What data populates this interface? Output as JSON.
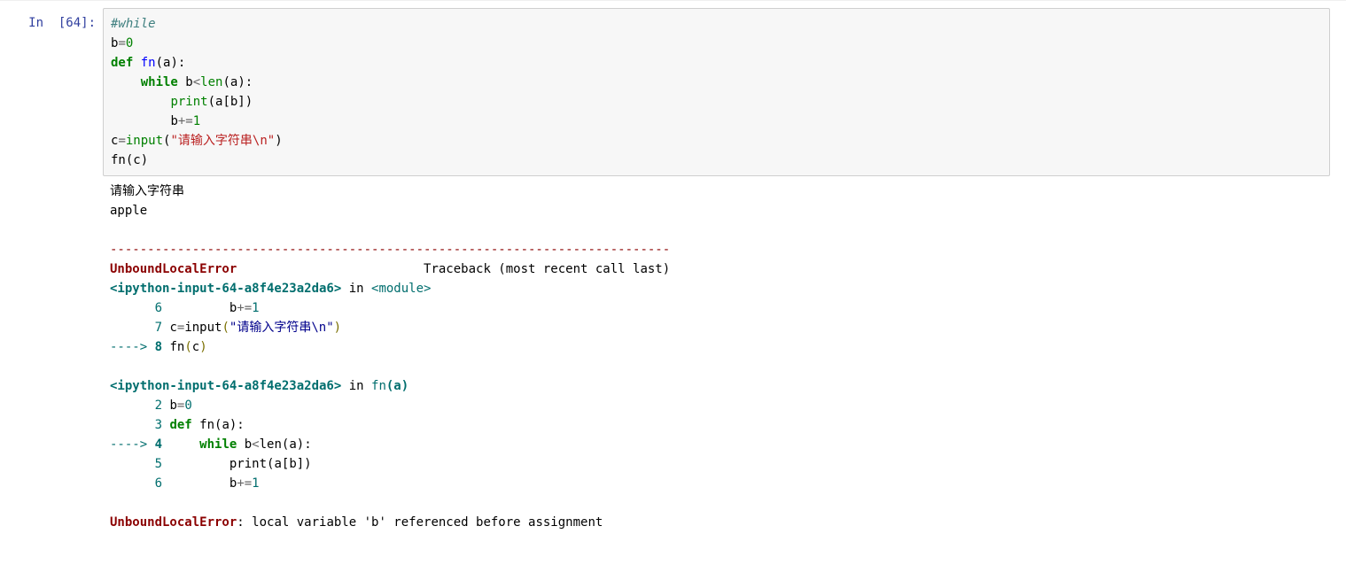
{
  "prompt": {
    "in_label": "In  [64]:"
  },
  "code": {
    "l1_comment": "#while",
    "l2_b": "b",
    "l2_eq": "=",
    "l2_zero": "0",
    "l3_def": "def",
    "l3_fn": " fn",
    "l3_open": "(a):",
    "l4_indent": "    ",
    "l4_while": "while",
    "l4_rest1": " b",
    "l4_lt": "<",
    "l4_len": "len",
    "l4_rest2": "(a):",
    "l5_indent": "        ",
    "l5_print": "print",
    "l5_rest": "(a[b])",
    "l6_indent": "        ",
    "l6_b": "b",
    "l6_peq": "+=",
    "l6_one": "1",
    "l7_c": "c",
    "l7_eq": "=",
    "l7_input": "input",
    "l7_open": "(",
    "l7_str": "\"请输入字符串\\n\"",
    "l7_close": ")",
    "l8": "fn(c)"
  },
  "out": {
    "stdin_line1": "请输入字符串",
    "stdin_line2": "apple",
    "hr": "---------------------------------------------------------------------------",
    "err_name": "UnboundLocalError",
    "err_pad": "                         ",
    "trace_tail": "Traceback (most recent call last)",
    "src1_a": "<ipython-input-64-a8f4e23a2da6>",
    "src1_in": " in ",
    "src1_mod": "<module>",
    "t1_l6_pre": "      ",
    "t1_l6_num": "6",
    "t1_l6_code": "         b",
    "t1_l6_op": "+=",
    "t1_l6_one": "1",
    "t1_l7_pre": "      ",
    "t1_l7_num": "7",
    "t1_l7_code_a": " c",
    "t1_l7_code_eq": "=",
    "t1_l7_code_b": "input",
    "t1_l7_code_p1": "(",
    "t1_l7_code_str": "\"请输入字符串\\n\"",
    "t1_l7_code_p2": ")",
    "t1_l8_arrow": "----> ",
    "t1_l8_num": "8",
    "t1_l8_code": " fn",
    "t1_l8_paren": "(",
    "t1_l8_arg": "c",
    "t1_l8_close": ")",
    "src2_a": "<ipython-input-64-a8f4e23a2da6>",
    "src2_in": " in ",
    "src2_fn": "fn",
    "src2_args": "(a)",
    "t2_l2_pre": "      ",
    "t2_l2_num": "2",
    "t2_l2_code": " b",
    "t2_l2_eq": "=",
    "t2_l2_zero": "0",
    "t2_l3_pre": "      ",
    "t2_l3_num": "3",
    "t2_l3_def": " def",
    "t2_l3_rest": " fn(a):",
    "t2_l4_arrow": "----> ",
    "t2_l4_num": "4",
    "t2_l4_while": "     while",
    "t2_l4_rest1": " b",
    "t2_l4_lt": "<",
    "t2_l4_len": "len",
    "t2_l4_rest2": "(a):",
    "t2_l5_pre": "      ",
    "t2_l5_num": "5",
    "t2_l5_print": "         print",
    "t2_l5_rest": "(a[b])",
    "t2_l6_pre": "      ",
    "t2_l6_num": "6",
    "t2_l6_code": "         b",
    "t2_l6_op": "+=",
    "t2_l6_one": "1",
    "final_err": "UnboundLocalError",
    "final_msg": ": local variable 'b' referenced before assignment"
  }
}
